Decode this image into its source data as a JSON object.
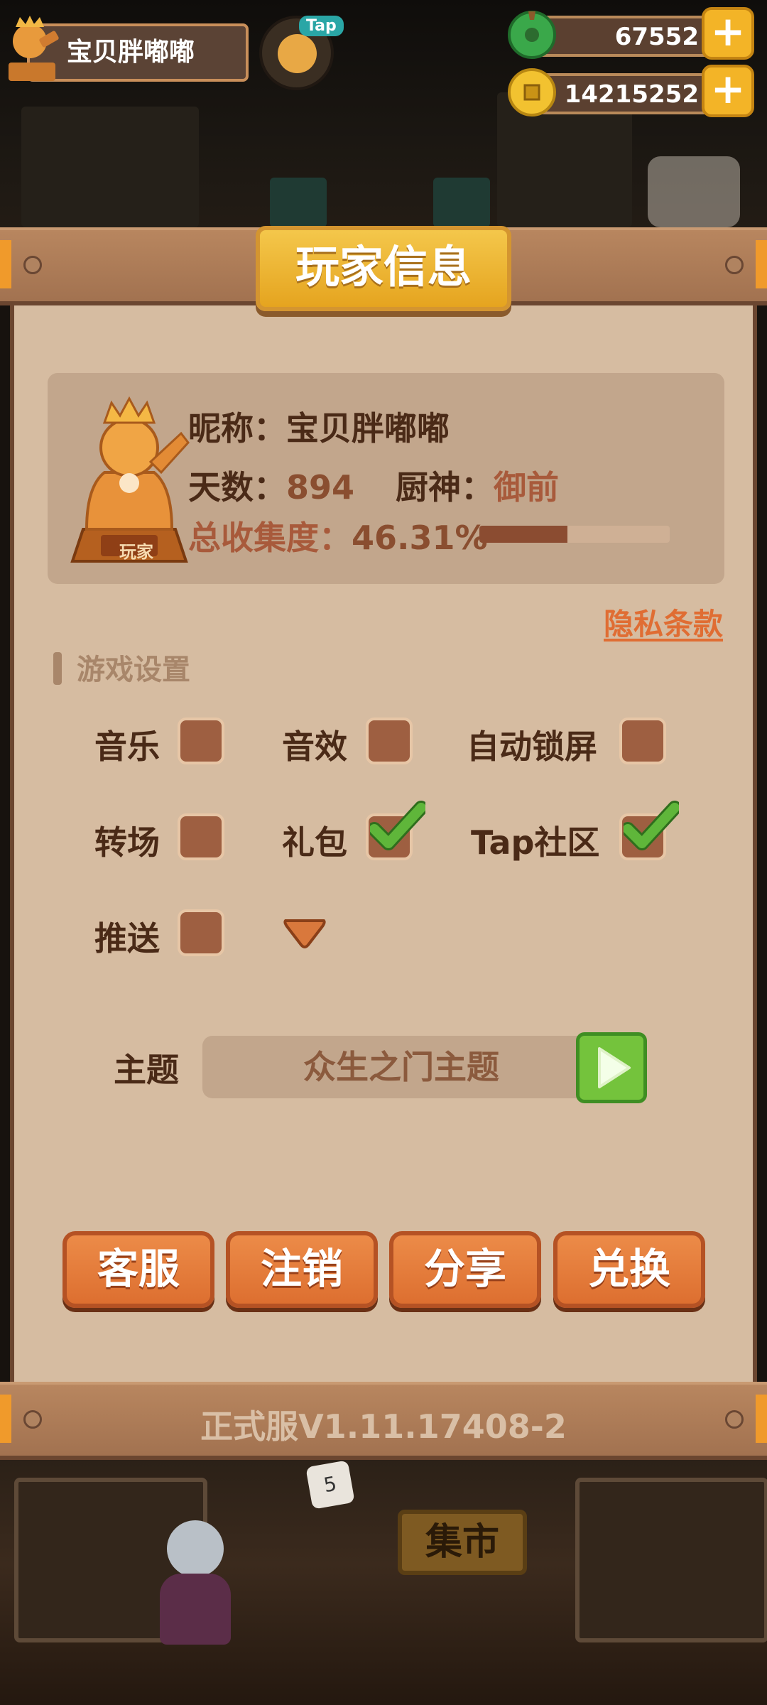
{
  "hud": {
    "player_name": "宝贝胖嘟嘟",
    "tap_badge": "Tap",
    "jade_amount": "67552",
    "coin_amount": "14215252",
    "plus_symbol": "+"
  },
  "dialog": {
    "title": "玩家信息",
    "info": {
      "nickname_label": "昵称：",
      "nickname": "宝贝胖嘟嘟",
      "days_label": "天数：",
      "days": "894",
      "chef_label": "厨神：",
      "chef": "御前",
      "collection_label": "总收集度：",
      "collection": "46.31%",
      "collection_fraction": 0.4631,
      "statue_plaque": "玩家"
    },
    "privacy_link": "隐私条款",
    "settings_title": "游戏设置",
    "options": [
      {
        "label": "音乐",
        "checked": false
      },
      {
        "label": "音效",
        "checked": false
      },
      {
        "label": "自动锁屏",
        "checked": false
      },
      {
        "label": "转场",
        "checked": false
      },
      {
        "label": "礼包",
        "checked": true
      },
      {
        "label": "Tap社区",
        "checked": true
      },
      {
        "label": "推送",
        "checked": false
      }
    ],
    "theme_label": "主题",
    "theme_value": "众生之门主题",
    "buttons": [
      "客服",
      "注销",
      "分享",
      "兑换"
    ],
    "version": "正式服V1.11.17408-2"
  },
  "scene": {
    "market_sign": "集市",
    "bubble_number": "5"
  },
  "colors": {
    "panel_bg": "#d6bca1",
    "accent_orange": "#e06d33",
    "title_gold": "#f3b427",
    "check_green": "#5fb63a"
  }
}
